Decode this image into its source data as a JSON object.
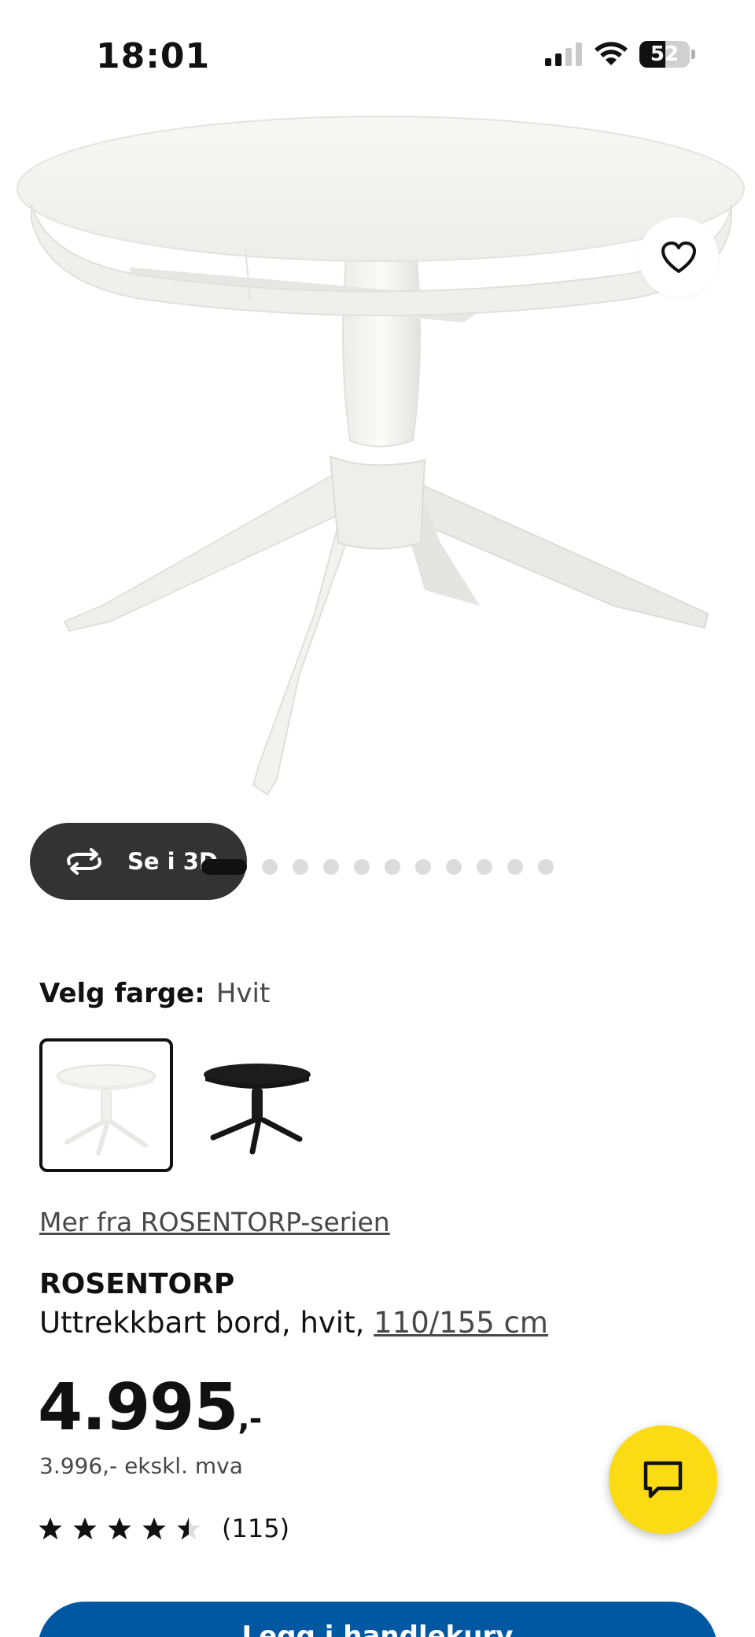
{
  "status_bar": {
    "time": "18:01",
    "battery": "52",
    "battery_level": 0.52,
    "icons": [
      "signal-icon",
      "wifi-icon",
      "battery-icon"
    ]
  },
  "hero": {
    "favorite_icon": "heart-icon",
    "view3d_label": "Se i 3D",
    "view3d_icon": "rotate-icon",
    "carousel": {
      "total": 11,
      "active": 0
    }
  },
  "color_selector": {
    "label": "Velg farge:",
    "value": "Hvit",
    "options": [
      {
        "name": "Hvit",
        "selected": true,
        "color": "#f4f4f2"
      },
      {
        "name": "Svart",
        "selected": false,
        "color": "#1c1c1c"
      }
    ]
  },
  "series_link": "Mer fra ROSENTORP-serien",
  "product": {
    "name": "ROSENTORP",
    "description": "Uttrekkbart bord, hvit, ",
    "size": "110/155 cm"
  },
  "price": {
    "amount": "4.995",
    "suffix": ",-",
    "ex_vat": "3.996,- ekskl. mva"
  },
  "rating": {
    "stars": 4.5,
    "count": "(115)"
  },
  "cart_button": {
    "label": "Legg i handlekurv"
  },
  "chat_icon": "chat-icon",
  "colors": {
    "accent_blue": "#0058a3",
    "chat_yellow": "#fadb14",
    "dark_pill": "#333333"
  }
}
